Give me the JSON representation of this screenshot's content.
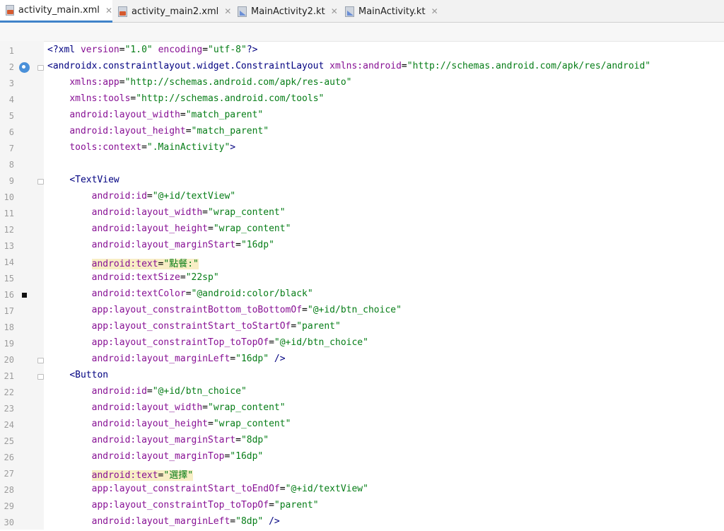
{
  "tabs": [
    {
      "label": "activity_main.xml",
      "icon": "xml-file-icon",
      "active": true
    },
    {
      "label": "activity_main2.xml",
      "icon": "xml-file-icon",
      "active": false
    },
    {
      "label": "MainActivity2.kt",
      "icon": "kotlin-file-icon",
      "active": false
    },
    {
      "label": "MainActivity.kt",
      "icon": "kotlin-file-icon",
      "active": false
    }
  ],
  "close_glyph": "✕",
  "editor": {
    "lines": [
      {
        "n": "1",
        "text": "<?xml version=\"1.0\" encoding=\"utf-8\"?>"
      },
      {
        "n": "2",
        "text": "<androidx.constraintlayout.widget.ConstraintLayout xmlns:android=\"http://schemas.android.com/apk/res/android\""
      },
      {
        "n": "3",
        "text": "    xmlns:app=\"http://schemas.android.com/apk/res-auto\""
      },
      {
        "n": "4",
        "text": "    xmlns:tools=\"http://schemas.android.com/tools\""
      },
      {
        "n": "5",
        "text": "    android:layout_width=\"match_parent\""
      },
      {
        "n": "6",
        "text": "    android:layout_height=\"match_parent\""
      },
      {
        "n": "7",
        "text": "    tools:context=\".MainActivity\">"
      },
      {
        "n": "8",
        "text": ""
      },
      {
        "n": "9",
        "text": "    <TextView"
      },
      {
        "n": "10",
        "text": "        android:id=\"@+id/textView\""
      },
      {
        "n": "11",
        "text": "        android:layout_width=\"wrap_content\""
      },
      {
        "n": "12",
        "text": "        android:layout_height=\"wrap_content\""
      },
      {
        "n": "13",
        "text": "        android:layout_marginStart=\"16dp\""
      },
      {
        "n": "14",
        "text": "        android:text=\"點餐:\""
      },
      {
        "n": "15",
        "text": "        android:textSize=\"22sp\""
      },
      {
        "n": "16",
        "text": "        android:textColor=\"@android:color/black\""
      },
      {
        "n": "17",
        "text": "        app:layout_constraintBottom_toBottomOf=\"@+id/btn_choice\""
      },
      {
        "n": "18",
        "text": "        app:layout_constraintStart_toStartOf=\"parent\""
      },
      {
        "n": "19",
        "text": "        app:layout_constraintTop_toTopOf=\"@+id/btn_choice\""
      },
      {
        "n": "20",
        "text": "        android:layout_marginLeft=\"16dp\" />"
      },
      {
        "n": "21",
        "text": "    <Button"
      },
      {
        "n": "22",
        "text": "        android:id=\"@+id/btn_choice\""
      },
      {
        "n": "23",
        "text": "        android:layout_width=\"wrap_content\""
      },
      {
        "n": "24",
        "text": "        android:layout_height=\"wrap_content\""
      },
      {
        "n": "25",
        "text": "        android:layout_marginStart=\"8dp\""
      },
      {
        "n": "26",
        "text": "        android:layout_marginTop=\"16dp\""
      },
      {
        "n": "27",
        "text": "        android:text=\"選擇\""
      },
      {
        "n": "28",
        "text": "        app:layout_constraintStart_toEndOf=\"@+id/textView\""
      },
      {
        "n": "29",
        "text": "        app:layout_constraintTop_toTopOf=\"parent\""
      },
      {
        "n": "30",
        "text": "        android:layout_marginLeft=\"8dp\" />"
      }
    ],
    "highlighted_lines": [
      "14",
      "27"
    ],
    "gutter_markers": {
      "design_icon_line": "2",
      "breakpoint_line": "16",
      "fold_lines": [
        "2",
        "9",
        "20",
        "21"
      ]
    }
  },
  "colors": {
    "tag": "#000080",
    "attribute": "#871094",
    "value": "#067d17",
    "highlight": "#f8eec5",
    "active_tab_underline": "#4083c9"
  }
}
